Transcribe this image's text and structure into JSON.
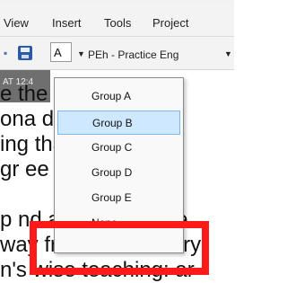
{
  "menubar": {
    "items": [
      "View",
      "Insert",
      "Tools",
      "Project"
    ]
  },
  "toolbar": {
    "group_value": "A",
    "project_label": "PEh  - Practice Eng"
  },
  "doc": {
    "timestamp": "AT 12:4",
    "lines": [
      "e the                       m th",
      "ona                          d I t",
      "ing                          thar",
      "gr                            ee",
      "p nd accuse You be",
      "way from her country",
      "n's wise teaching: ar"
    ]
  },
  "dropdown": {
    "items": [
      "Group A",
      "Group B",
      "Group C",
      "Group D",
      "Group E",
      "None"
    ],
    "selected_index": 1
  },
  "colors": {
    "highlight": "#ff1a1a",
    "selection": "#cde8ff"
  }
}
